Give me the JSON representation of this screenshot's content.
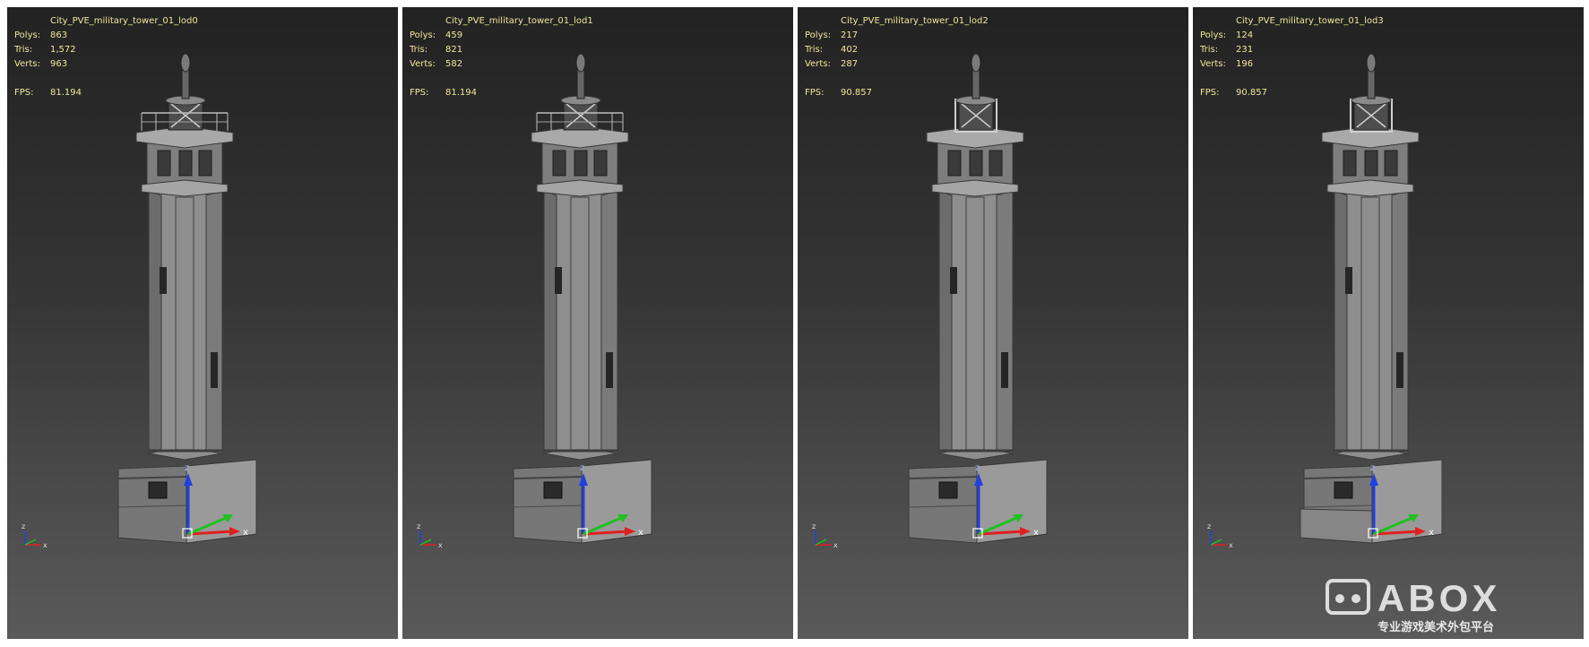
{
  "viewports": [
    {
      "title": "City_PVE_military_tower_01_lod0",
      "labels": {
        "polys": "Polys:",
        "tris": "Tris:",
        "verts": "Verts:",
        "fps": "FPS:"
      },
      "polys": "863",
      "tris": "1,572",
      "verts": "963",
      "fps": "81.194",
      "has_railing": true,
      "has_cap_panel": false,
      "has_base_step": false
    },
    {
      "title": "City_PVE_military_tower_01_lod1",
      "labels": {
        "polys": "Polys:",
        "tris": "Tris:",
        "verts": "Verts:",
        "fps": "FPS:"
      },
      "polys": "459",
      "tris": "821",
      "verts": "582",
      "fps": "81.194",
      "has_railing": true,
      "has_cap_panel": false,
      "has_base_step": false
    },
    {
      "title": "City_PVE_military_tower_01_lod2",
      "labels": {
        "polys": "Polys:",
        "tris": "Tris:",
        "verts": "Verts:",
        "fps": "FPS:"
      },
      "polys": "217",
      "tris": "402",
      "verts": "287",
      "fps": "90.857",
      "has_railing": false,
      "has_cap_panel": true,
      "has_base_step": false
    },
    {
      "title": "City_PVE_military_tower_01_lod3",
      "labels": {
        "polys": "Polys:",
        "tris": "Tris:",
        "verts": "Verts:",
        "fps": "FPS:"
      },
      "polys": "124",
      "tris": "231",
      "verts": "196",
      "fps": "90.857",
      "has_railing": false,
      "has_cap_panel": true,
      "has_base_step": true
    }
  ],
  "gizmo": {
    "x_label": "x",
    "y_label": "y",
    "z_label": "z"
  },
  "watermark": {
    "text": "ABOX",
    "subtitle": "专业游戏美术外包平台"
  },
  "colors": {
    "stats_text": "#f0e69a",
    "axis_x": "#e02020",
    "axis_y": "#20c020",
    "axis_z": "#2040e0",
    "selection_box": "#ffffff"
  }
}
